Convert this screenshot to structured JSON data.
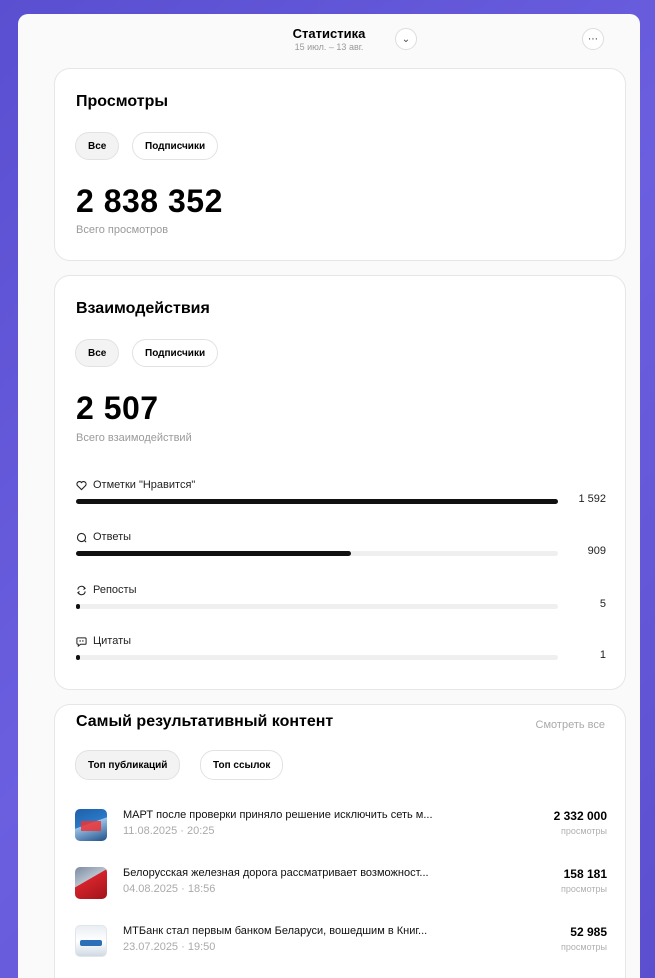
{
  "header": {
    "title": "Статистика",
    "subtitle": "15 июл. – 13 авг."
  },
  "views": {
    "title": "Просмотры",
    "filters": [
      "Все",
      "Подписчики"
    ],
    "total": "2 838 352",
    "caption": "Всего просмотров"
  },
  "interactions": {
    "title": "Взаимодействия",
    "filters": [
      "Все",
      "Подписчики"
    ],
    "total": "2 507",
    "caption": "Всего взаимодействий",
    "metrics": [
      {
        "label": "Отметки \"Нравится\"",
        "value": "1 592",
        "fraction": 1.0,
        "icon": "heart-icon"
      },
      {
        "label": "Ответы",
        "value": "909",
        "fraction": 0.571,
        "icon": "comment-icon"
      },
      {
        "label": "Репосты",
        "value": "5",
        "fraction": 0.003,
        "icon": "repost-icon"
      },
      {
        "label": "Цитаты",
        "value": "1",
        "fraction": 0.001,
        "icon": "quote-icon"
      }
    ]
  },
  "top": {
    "title": "Самый результативный контент",
    "see_all": "Смотреть все",
    "tabs": [
      "Топ публикаций",
      "Топ ссылок"
    ],
    "items": [
      {
        "title": "МАРТ после проверки приняло решение исключить сеть м...",
        "date": "11.08.2025 · 20:25",
        "count": "2 332 000",
        "unit": "просмотры"
      },
      {
        "title": "Белорусская железная дорога рассматривает возможност...",
        "date": "04.08.2025 · 18:56",
        "count": "158 181",
        "unit": "просмотры"
      },
      {
        "title": "МТБанк стал первым банком Беларуси, вошедшим в Книг...",
        "date": "23.07.2025 · 19:50",
        "count": "52 985",
        "unit": "просмотры"
      }
    ]
  }
}
